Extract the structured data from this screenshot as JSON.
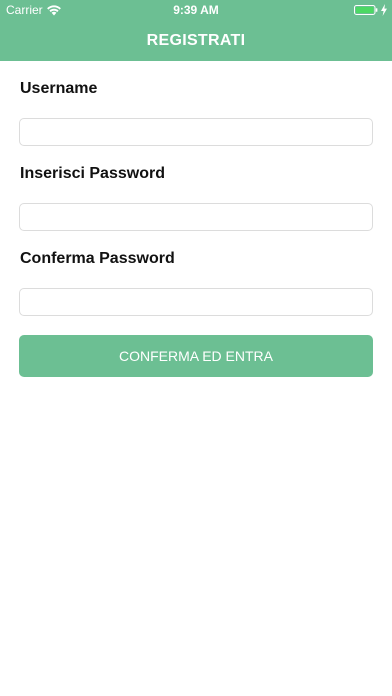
{
  "status_bar": {
    "carrier": "Carrier",
    "time": "9:39 AM",
    "icons": [
      "wifi-icon",
      "battery-icon",
      "charging-bolt-icon"
    ]
  },
  "nav": {
    "title": "REGISTRATI"
  },
  "form": {
    "username_label": "Username",
    "username_value": "",
    "password_label": "Inserisci Password",
    "password_value": "",
    "confirm_label": "Conferma Password",
    "confirm_value": "",
    "submit_label": "CONFERMA ED ENTRA"
  },
  "colors": {
    "accent": "#6cbf93",
    "background": "#ffffff",
    "input_border": "#dcdcdc",
    "label_text": "#111111"
  }
}
